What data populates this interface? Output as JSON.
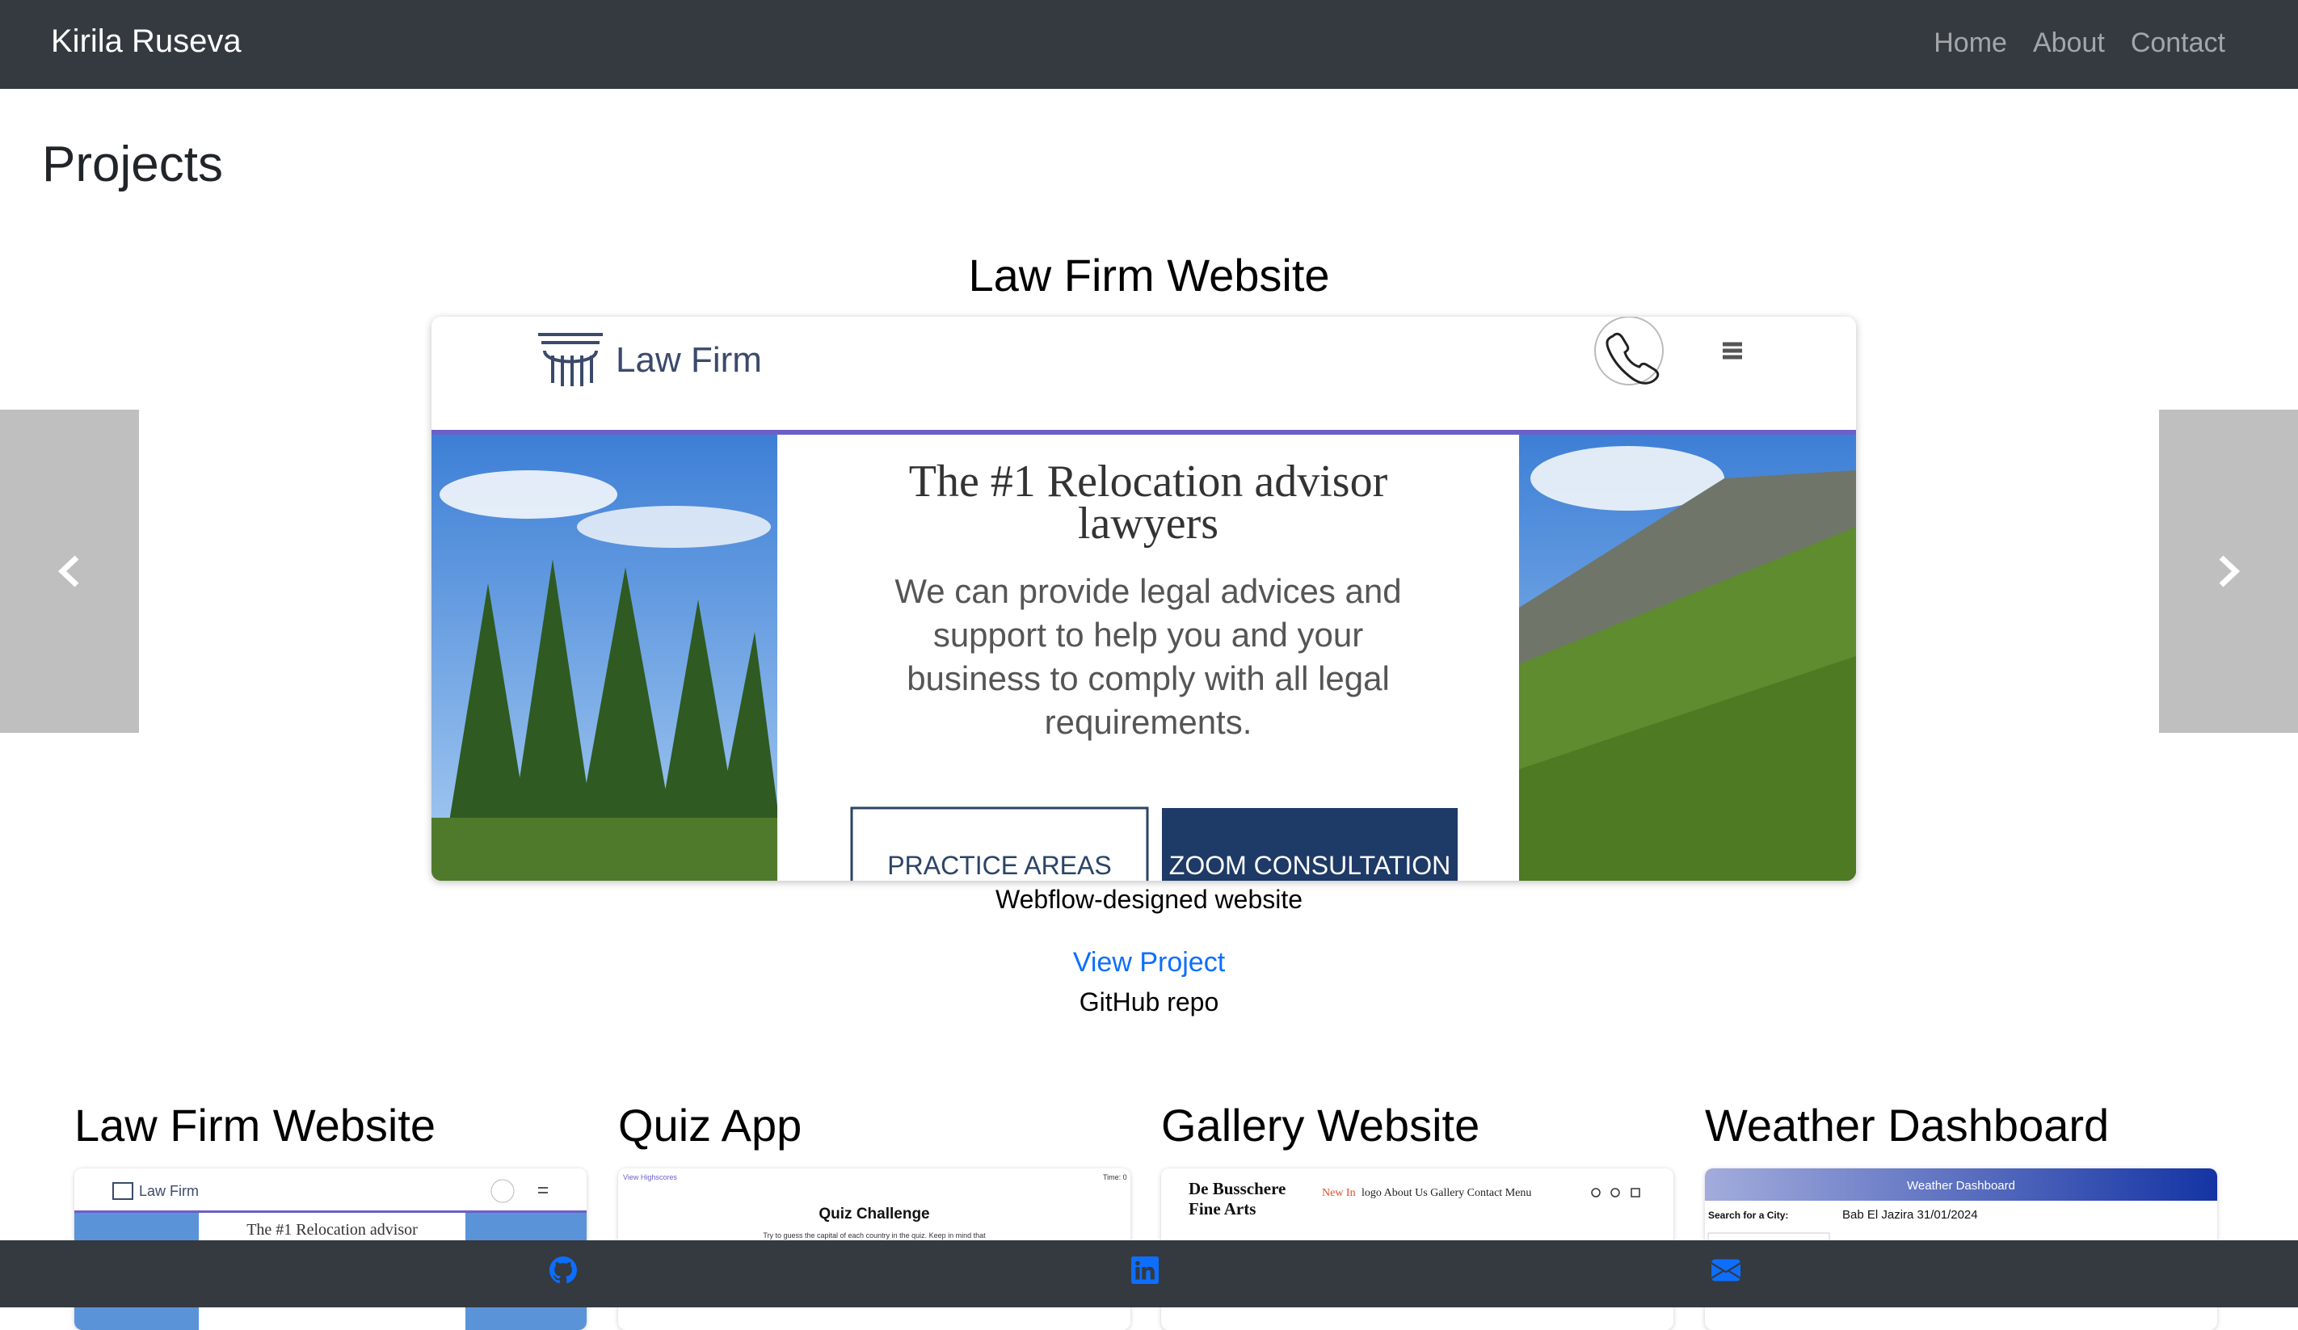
{
  "navbar": {
    "brand": "Kirila Ruseva",
    "links": [
      "Home",
      "About",
      "Contact"
    ]
  },
  "page_title": "Projects",
  "carousel": {
    "slide_title": "Law Firm Website",
    "caption": "Webflow-designed website",
    "view_link": "View Project",
    "repo_text": "GitHub repo",
    "screenshot": {
      "logo_text": "Law Firm",
      "headline": "The #1 Relocation advisor lawyers",
      "body": "We can provide legal advices and support to help you and your business to comply with all legal requirements.",
      "button_1": "PRACTICE AREAS",
      "button_2": "ZOOM CONSULTATION"
    }
  },
  "cards": [
    {
      "title": "Law Firm Website",
      "thumb": {
        "logo": "Law Firm",
        "headline": "The #1 Relocation advisor"
      }
    },
    {
      "title": "Quiz App",
      "thumb": {
        "top_left": "View Highscores",
        "top_right": "Time: 0",
        "heading": "Quiz Challenge",
        "body": "Try to guess the capital of each country in the quiz. Keep in mind that"
      }
    },
    {
      "title": "Gallery Website",
      "thumb": {
        "brand_line1": "De Busschere",
        "brand_line2": "Fine Arts",
        "nav_new": "New In",
        "nav_rest": "logo  About Us  Gallery  Contact  Menu"
      }
    },
    {
      "title": "Weather Dashboard",
      "thumb": {
        "header": "Weather Dashboard",
        "search_label": "Search for a City:",
        "city": "Bab El Jazira 31/01/2024"
      }
    }
  ],
  "footer": {
    "icons": [
      "github-icon",
      "linkedin-icon",
      "envelope-icon"
    ],
    "icon_color": "#0d6efd"
  }
}
